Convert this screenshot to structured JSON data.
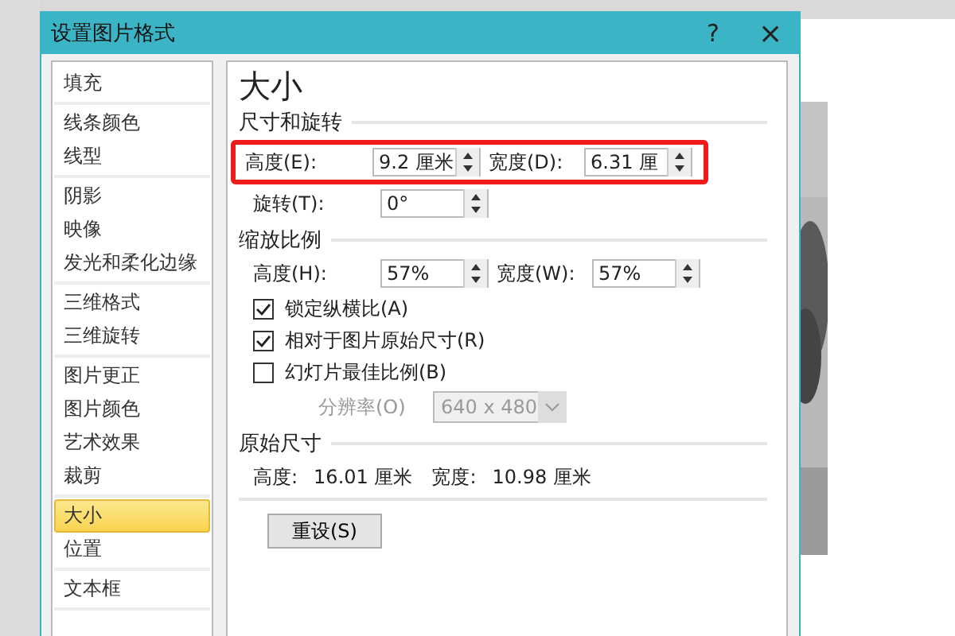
{
  "window": {
    "title": "设置图片格式",
    "help": "?",
    "close": "×"
  },
  "sidebar": {
    "groups": [
      [
        {
          "label": "填充",
          "selected": false
        }
      ],
      [
        {
          "label": "线条颜色",
          "selected": false
        },
        {
          "label": "线型",
          "selected": false
        }
      ],
      [
        {
          "label": "阴影",
          "selected": false
        },
        {
          "label": "映像",
          "selected": false
        },
        {
          "label": "发光和柔化边缘",
          "selected": false
        }
      ],
      [
        {
          "label": "三维格式",
          "selected": false
        },
        {
          "label": "三维旋转",
          "selected": false
        }
      ],
      [
        {
          "label": "图片更正",
          "selected": false
        },
        {
          "label": "图片颜色",
          "selected": false
        },
        {
          "label": "艺术效果",
          "selected": false
        },
        {
          "label": "裁剪",
          "selected": false
        }
      ],
      [
        {
          "label": "大小",
          "selected": true
        },
        {
          "label": "位置",
          "selected": false
        }
      ],
      [
        {
          "label": "文本框",
          "selected": false
        }
      ]
    ]
  },
  "panel": {
    "heading": "大小",
    "size_rotate": {
      "title": "尺寸和旋转",
      "highlighted": true,
      "height": {
        "label": "高度(E):",
        "value": "9.2 厘米"
      },
      "width": {
        "label": "宽度(D):",
        "value": "6.31 厘"
      },
      "rotation": {
        "label": "旋转(T):",
        "value": "0°"
      }
    },
    "scale": {
      "title": "缩放比例",
      "height": {
        "label": "高度(H):",
        "value": "57%"
      },
      "width": {
        "label": "宽度(W):",
        "value": "57%"
      },
      "options": [
        {
          "label": "锁定纵横比(A)",
          "checked": true
        },
        {
          "label": "相对于图片原始尺寸(R)",
          "checked": true
        },
        {
          "label": "幻灯片最佳比例(B)",
          "checked": false
        }
      ],
      "resolution": {
        "label": "分辨率(O)",
        "value": "640 x 480",
        "disabled": true
      }
    },
    "original": {
      "title": "原始尺寸",
      "height_label": "高度:",
      "height_value": "16.01 厘米",
      "width_label": "宽度:",
      "width_value": "10.98 厘米"
    },
    "reset_button": "重设(S)"
  }
}
